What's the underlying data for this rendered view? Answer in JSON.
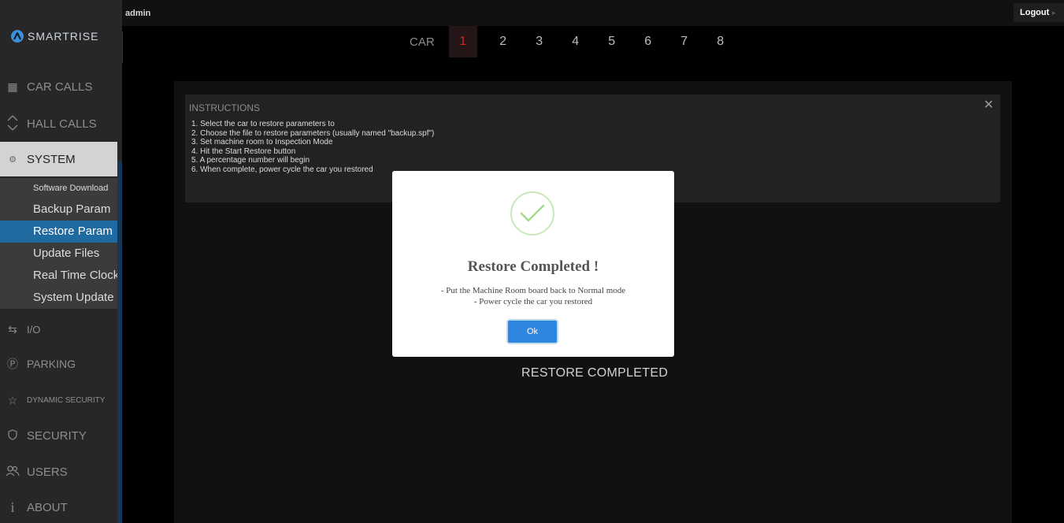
{
  "app": {
    "brand": "SMARTRISE",
    "user": "admin",
    "logout": "Logout"
  },
  "sidebar": {
    "nav": [
      {
        "label": "CAR CALLS",
        "icon": "car-calls-icon"
      },
      {
        "label": "HALL CALLS",
        "icon": "hall-calls-icon"
      },
      {
        "label": "SYSTEM",
        "icon": "gear-icon",
        "active": true
      },
      {
        "label": "I/O",
        "icon": "io-icon"
      },
      {
        "label": "PARKING",
        "icon": "parking-icon"
      },
      {
        "label": "DYNAMIC SECURITY",
        "icon": "star-icon"
      },
      {
        "label": "SECURITY",
        "icon": "shield-icon"
      },
      {
        "label": "USERS",
        "icon": "users-icon"
      },
      {
        "label": "ABOUT",
        "icon": "info-icon"
      }
    ],
    "system_items": [
      "Software Download",
      "Backup Param",
      "Restore Param",
      "Update Files",
      "Real Time Clock",
      "System Update"
    ],
    "selected_item": "Restore Param"
  },
  "cars": {
    "label": "CAR",
    "numbers": [
      "1",
      "2",
      "3",
      "4",
      "5",
      "6",
      "7",
      "8"
    ],
    "selected": "1"
  },
  "instructions": {
    "title": "INSTRUCTIONS",
    "lines": [
      "1. Select the car to restore parameters to",
      "2. Choose the file to restore parameters (usually named \"backup.spf\")",
      "3. Set machine room to Inspection Mode",
      "4. Hit the Start Restore button",
      "5. A percentage number will begin",
      "6. When complete, power cycle the car you restored"
    ]
  },
  "status": "RESTORE COMPLETED",
  "modal": {
    "title": "Restore Completed !",
    "line1": "- Put the Machine Room board back to Normal mode",
    "line2": "- Power cycle the car you restored",
    "ok": "Ok"
  },
  "colors": {
    "accent": "#1f6aa1",
    "selected_car": "#d42424",
    "ok_button": "#2e86e0",
    "check": "#a5dc86"
  }
}
